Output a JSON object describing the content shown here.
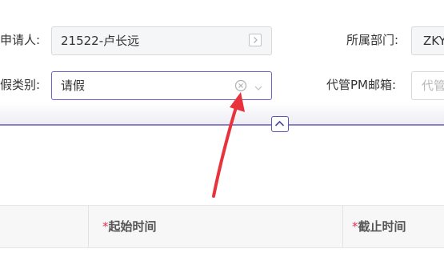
{
  "form": {
    "applicant": {
      "label": "申请人:",
      "value": "21522-卢长远"
    },
    "department": {
      "label": "所属部门:",
      "value": "ZKY"
    },
    "leave_type": {
      "label": "假类别:",
      "value": "请假"
    },
    "pm_email": {
      "label": "代管PM邮箱:",
      "placeholder": "代管"
    }
  },
  "table": {
    "headers": [
      {
        "required": "",
        "label": ""
      },
      {
        "required": "*",
        "label": "起始时间"
      },
      {
        "required": "*",
        "label": "截止时间"
      }
    ]
  },
  "colors": {
    "accent": "#6f63c9",
    "annotation_arrow": "#e8333c",
    "required": "#e0364b"
  },
  "icons": {
    "lookup": "lookup-square-icon",
    "clear": "clear-circle-icon",
    "dropdown": "chevron-down-icon",
    "collapse": "chevron-up-icon",
    "annotation": "red-arrow-annotation"
  }
}
